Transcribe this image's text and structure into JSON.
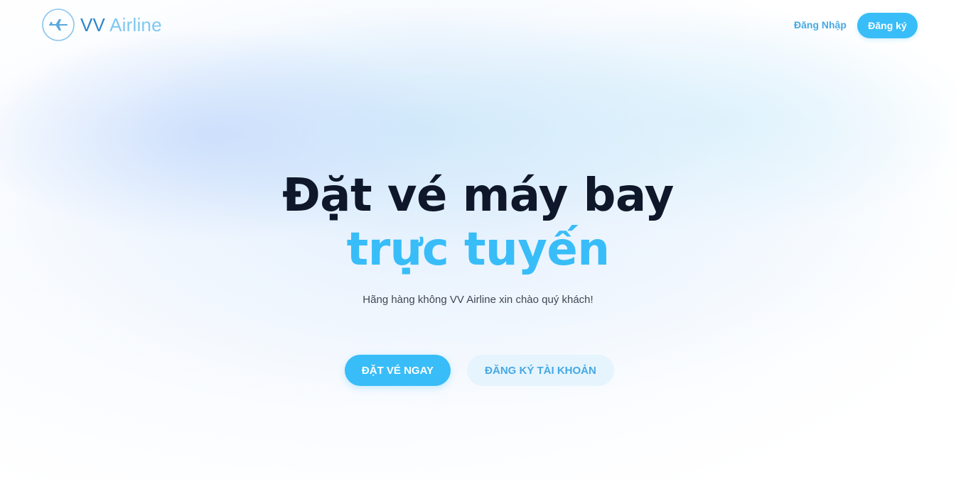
{
  "header": {
    "logo": {
      "icon": "airplane-icon",
      "brand_part1": "VV",
      "brand_part2": "Airline"
    },
    "nav": {
      "login_label": "Đăng Nhập",
      "register_label": "Đăng ký"
    }
  },
  "hero": {
    "title_line1": "Đặt vé máy bay",
    "title_line2": "trực tuyến",
    "subtitle": "Hãng hàng không VV Airline xin chào quý khách!",
    "primary_button_label": "ĐẶT VÉ NGAY",
    "secondary_button_label": "ĐĂNG KÝ TÀI KHOẢN"
  },
  "colors": {
    "accent": "#38bdf8",
    "accent_text": "#46a9e4",
    "title_dark": "#0f172a",
    "secondary_button_bg": "#e5f4fd",
    "logo_vv": "#2f86c9",
    "logo_airline": "#7ec8f1"
  }
}
